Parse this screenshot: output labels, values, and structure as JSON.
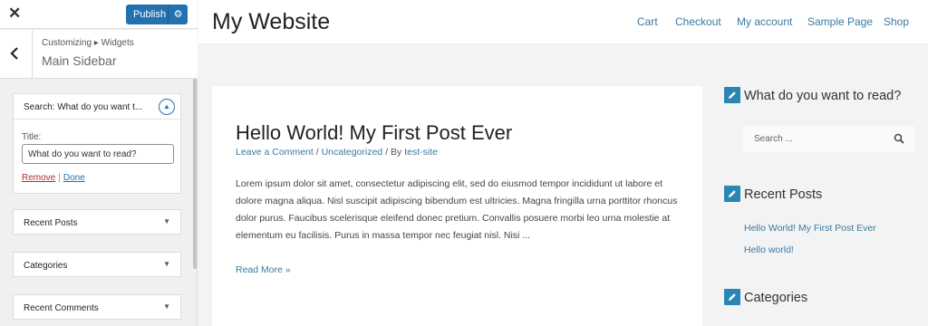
{
  "customizer": {
    "close_icon": "close-icon",
    "publish_label": "Publish",
    "breadcrumb": "Customizing ▸ Widgets",
    "section_title": "Main Sidebar",
    "search_widget": {
      "header": "Search: What do you want t...",
      "title_label": "Title:",
      "title_value": "What do you want to read?",
      "remove_label": "Remove",
      "separator": "|",
      "done_label": "Done"
    },
    "collapsed_widgets": [
      "Recent Posts",
      "Categories",
      "Recent Comments"
    ]
  },
  "site": {
    "title": "My Website",
    "nav": [
      "Cart",
      "Checkout",
      "My account",
      "Sample Page",
      "Shop"
    ],
    "post": {
      "title": "Hello World! My First Post Ever",
      "meta": {
        "comment_link": "Leave a Comment",
        "sep1": " / ",
        "category": "Uncategorized",
        "by_prefix": " / By ",
        "author": "test-site"
      },
      "excerpt": "Lorem ipsum dolor sit amet, consectetur adipiscing elit, sed do eiusmod tempor incididunt ut labore et dolore magna aliqua. Nisl suscipit adipiscing bibendum est ultricies. Magna fringilla urna porttitor rhoncus dolor purus. Faucibus scelerisque eleifend donec pretium. Convallis posuere morbi leo urna molestie at elementum eu facilisis. Purus in massa tempor nec feugiat nisl. Nisi ...",
      "read_more": "Read More »"
    },
    "sidebar": {
      "search_heading": "What do you want to read?",
      "search_placeholder": "Search ...",
      "recent_heading": "Recent Posts",
      "recent_posts": [
        "Hello World! My First Post Ever",
        "Hello world!"
      ],
      "categories_heading": "Categories"
    }
  },
  "colors": {
    "publish_button": "#2271b1",
    "link": "#3a7aa0",
    "widget_icon": "#2a86b4",
    "remove_link": "#b32d2e"
  }
}
